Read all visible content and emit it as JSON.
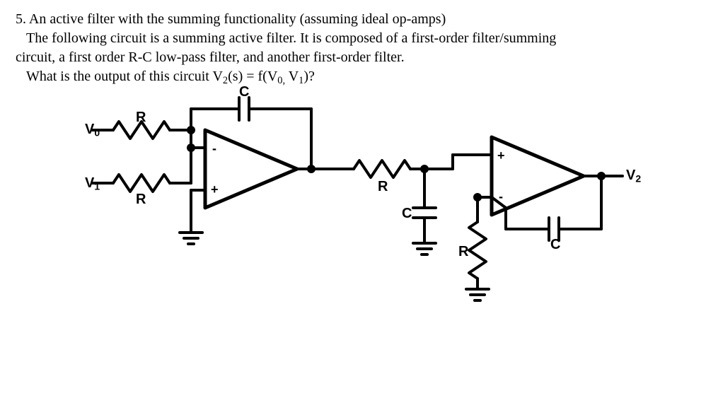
{
  "problem": {
    "number": "5.",
    "line1_a": "An active filter with the summing functionality (assuming ideal op-amps)",
    "line2_a": "The following circuit is a summing active filter. It is composed of a first-order filter/summing",
    "line2_b": "circuit, a first order R-C low-pass filter, and another first-order filter.",
    "question_a": "What is the output of this circuit V",
    "question_sub1": "2",
    "question_b": "(s) = f(V",
    "question_sub2": "0,",
    "question_c": " V",
    "question_sub3": "1",
    "question_d": ")?"
  },
  "labels": {
    "V0": "V",
    "V0_sub": "0",
    "V1": "V",
    "V1_sub": "1",
    "V2": "V",
    "V2_sub": "2",
    "R_in_top": "R",
    "R_in_bot": "R",
    "C_fb1": "C",
    "R_rc": "R",
    "C_rc": "C",
    "R_gnd2": "R",
    "C_fb2": "C",
    "plus": "+",
    "minus": "−"
  }
}
